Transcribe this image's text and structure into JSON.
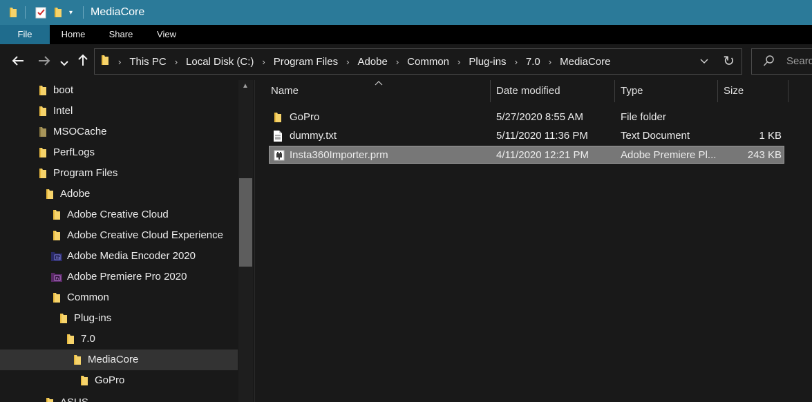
{
  "window": {
    "title": "MediaCore"
  },
  "quick_access": {
    "folder_icon": "folder-icon",
    "properties_icon": "properties-checkmark-icon",
    "new_folder_icon": "new-folder-icon",
    "customize_icon": "dropdown-arrow-icon"
  },
  "ribbon": {
    "tabs": [
      {
        "label": "File",
        "active": true
      },
      {
        "label": "Home",
        "active": false
      },
      {
        "label": "Share",
        "active": false
      },
      {
        "label": "View",
        "active": false
      }
    ]
  },
  "navigation": {
    "back_icon": "arrow-left-icon",
    "forward_icon": "arrow-right-icon",
    "recent_icon": "chevron-down-icon",
    "up_icon": "arrow-up-icon"
  },
  "address_bar": {
    "breadcrumbs": [
      "This PC",
      "Local Disk (C:)",
      "Program Files",
      "Adobe",
      "Common",
      "Plug-ins",
      "7.0",
      "MediaCore"
    ],
    "refresh_icon": "refresh-icon"
  },
  "search": {
    "placeholder": "Search"
  },
  "nav_pane": {
    "items": [
      {
        "label": "boot",
        "icon": "folder-icon",
        "level": 0
      },
      {
        "label": "Intel",
        "icon": "folder-icon",
        "level": 0
      },
      {
        "label": "MSOCache",
        "icon": "folder-icon",
        "level": 0
      },
      {
        "label": "PerfLogs",
        "icon": "folder-icon",
        "level": 0
      },
      {
        "label": "Program Files",
        "icon": "folder-icon",
        "level": 0
      },
      {
        "label": "Adobe",
        "icon": "folder-icon",
        "level": 1
      },
      {
        "label": "Adobe Creative Cloud",
        "icon": "folder-icon",
        "level": 2
      },
      {
        "label": "Adobe Creative Cloud Experience",
        "icon": "folder-icon",
        "level": 2
      },
      {
        "label": "Adobe Media Encoder 2020",
        "icon": "media-encoder-icon",
        "level": 2
      },
      {
        "label": "Adobe Premiere Pro 2020",
        "icon": "premiere-pro-icon",
        "level": 2
      },
      {
        "label": "Common",
        "icon": "folder-icon",
        "level": 2
      },
      {
        "label": "Plug-ins",
        "icon": "folder-icon",
        "level": 3
      },
      {
        "label": "7.0",
        "icon": "folder-icon",
        "level": 4
      },
      {
        "label": "MediaCore",
        "icon": "folder-icon",
        "level": 5,
        "selected": true
      },
      {
        "label": "GoPro",
        "icon": "folder-icon",
        "level": 6
      },
      {
        "label": "ASUS",
        "icon": "folder-icon",
        "level": 1
      }
    ]
  },
  "file_list": {
    "columns": [
      "Name",
      "Date modified",
      "Type",
      "Size"
    ],
    "rows": [
      {
        "name": "GoPro",
        "date": "5/27/2020 8:55 AM",
        "type": "File folder",
        "size": "",
        "icon": "folder-icon"
      },
      {
        "name": "dummy.txt",
        "date": "5/11/2020 11:36 PM",
        "type": "Text Document",
        "size": "1 KB",
        "icon": "text-document-icon"
      },
      {
        "name": "Insta360Importer.prm",
        "date": "4/11/2020 12:21 PM",
        "type": "Adobe Premiere Pl...",
        "size": "243 KB",
        "icon": "plugin-file-icon",
        "selected": true
      }
    ]
  },
  "colors": {
    "titlebar": "#2b7a99",
    "active_tab": "#1f6c8d",
    "folder": "#f6d36a",
    "selection": "#777777"
  }
}
